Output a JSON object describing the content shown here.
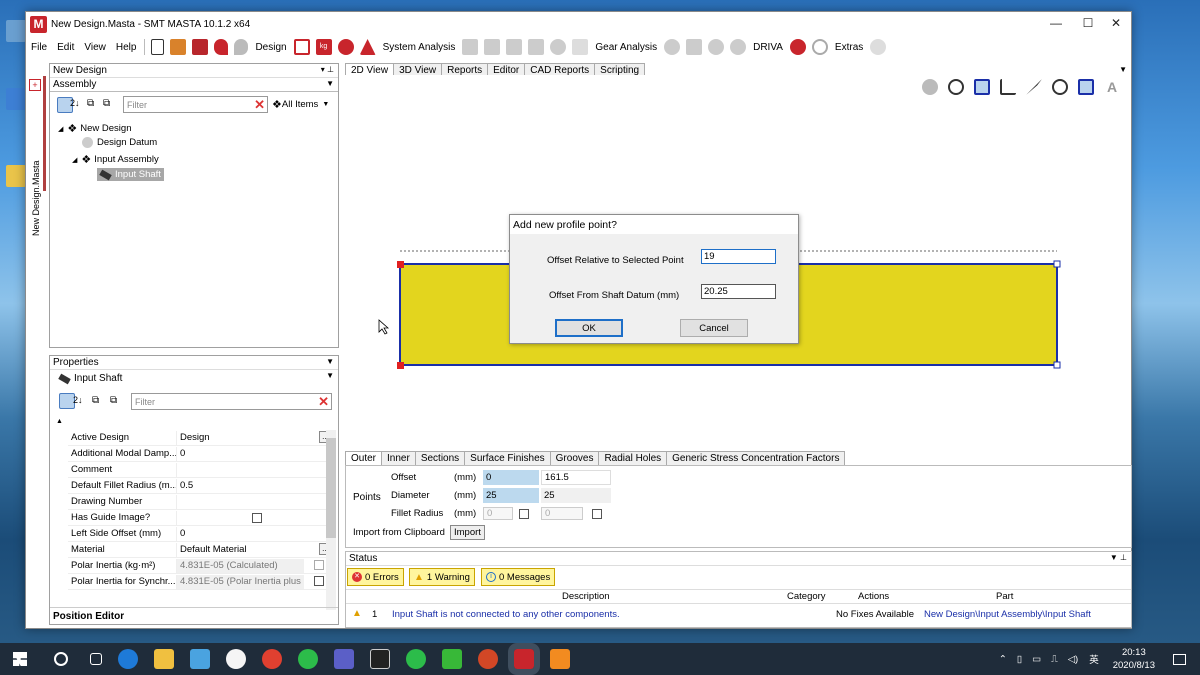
{
  "window": {
    "title": "New Design.Masta - SMT MASTA 10.1.2 x64",
    "logo_letter": "M"
  },
  "window_controls": {
    "minimize": "—",
    "maximize": "☐",
    "close": "✕"
  },
  "menu": [
    "File",
    "Edit",
    "View",
    "Help"
  ],
  "toolbar": {
    "design_label": "Design",
    "system_analysis_label": "System Analysis",
    "gear_analysis_label": "Gear Analysis",
    "driva_label": "DRIVA",
    "extras_label": "Extras",
    "kg_label": "kg"
  },
  "side_tab": {
    "label": "New Design.Masta"
  },
  "tree_panel": {
    "title": "New Design",
    "dropdown": "Assembly",
    "filter_placeholder": "Filter",
    "all_items": "All Items",
    "items": [
      "New Design",
      "Design Datum",
      "Input Assembly",
      "Input Shaft"
    ]
  },
  "properties": {
    "title": "Properties",
    "selected": "Input Shaft",
    "filter_placeholder": "Filter",
    "rows": [
      {
        "key": "Active Design",
        "value": "Design"
      },
      {
        "key": "Additional Modal Damp...",
        "value": "0"
      },
      {
        "key": "Comment",
        "value": ""
      },
      {
        "key": "Default Fillet Radius (m...",
        "value": "0.5"
      },
      {
        "key": "Drawing Number",
        "value": ""
      },
      {
        "key": "Has Guide Image?",
        "value": ""
      },
      {
        "key": "Left Side Offset (mm)",
        "value": "0"
      },
      {
        "key": "Material",
        "value": "Default Material"
      },
      {
        "key": "Polar Inertia (kg·m²)",
        "value": "4.831E-05 (Calculated)"
      },
      {
        "key": "Polar Inertia for Synchr...",
        "value": "4.831E-05 (Polar Inertia plus"
      }
    ],
    "footer": "Position Editor"
  },
  "view_tabs": [
    "2D View",
    "3D View",
    "Reports",
    "Editor",
    "CAD Reports",
    "Scripting"
  ],
  "dialog": {
    "title": "Add new profile point?",
    "label1": "Offset Relative to Selected Point",
    "value1": "19",
    "label2": "Offset From Shaft Datum (mm)",
    "value2": "20.25",
    "ok": "OK",
    "cancel": "Cancel"
  },
  "bottom_tabs": [
    "Outer",
    "Inner",
    "Sections",
    "Surface Finishes",
    "Grooves",
    "Radial Holes",
    "Generic Stress Concentration Factors"
  ],
  "points_editor": {
    "group_label": "Points",
    "rows": [
      {
        "name": "Offset",
        "unit": "(mm)",
        "v1": "0",
        "v2": "161.5"
      },
      {
        "name": "Diameter",
        "unit": "(mm)",
        "v1": "25",
        "v2": "25"
      },
      {
        "name": "Fillet Radius",
        "unit": "(mm)",
        "v1": "0",
        "v2": "0"
      }
    ],
    "import_label": "Import from Clipboard",
    "import_button": "Import"
  },
  "status": {
    "title": "Status",
    "errors": "0 Errors",
    "warnings": "1 Warning",
    "messages": "0 Messages",
    "columns": [
      "Description",
      "Category",
      "Actions",
      "Part"
    ],
    "rows": [
      {
        "index": "1",
        "description": "Input Shaft is not connected to any other components.",
        "category": "",
        "actions": "No Fixes Available",
        "part": "New Design\\Input Assembly\\Input Shaft"
      }
    ]
  },
  "taskbar": {
    "ime": "英",
    "time": "20:13",
    "date": "2020/8/13"
  },
  "colors": {
    "shaft_fill": "#e3d51e",
    "shaft_outline": "#1a2fa8",
    "accent_red": "#c8252c"
  }
}
